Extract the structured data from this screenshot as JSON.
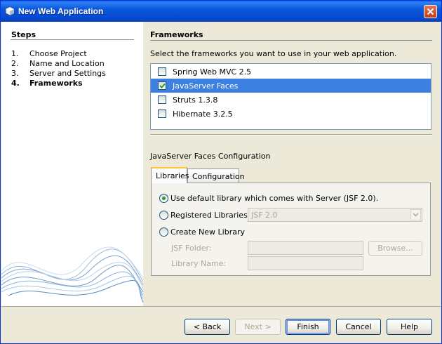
{
  "window": {
    "title": "New Web Application"
  },
  "steps": {
    "title": "Steps",
    "items": [
      {
        "num": "1.",
        "label": "Choose Project"
      },
      {
        "num": "2.",
        "label": "Name and Location"
      },
      {
        "num": "3.",
        "label": "Server and Settings"
      },
      {
        "num": "4.",
        "label": "Frameworks"
      }
    ]
  },
  "main": {
    "title": "Frameworks",
    "description": "Select the frameworks you want to use in your web application.",
    "frameworks": [
      {
        "label": "Spring Web MVC 2.5",
        "checked": false
      },
      {
        "label": "JavaServer Faces",
        "checked": true
      },
      {
        "label": "Struts 1.3.8",
        "checked": false
      },
      {
        "label": "Hibernate 3.2.5",
        "checked": false
      }
    ],
    "config_title": "JavaServer Faces Configuration",
    "tabs": [
      {
        "label": "Libraries"
      },
      {
        "label": "Configuration"
      }
    ],
    "libraries": {
      "option_default": "Use default library which comes with Server (JSF 2.0).",
      "option_registered": "Registered Libraries:",
      "registered_value": "JSF 2.0",
      "option_new": "Create New Library",
      "jsf_folder_label": "JSF Folder:",
      "library_name_label": "Library Name:",
      "browse_label": "Browse..."
    }
  },
  "buttons": {
    "back": "< Back",
    "next": "Next >",
    "finish": "Finish",
    "cancel": "Cancel",
    "help": "Help"
  },
  "colors": {
    "selection": "#3d80df",
    "titlebar": "#0a58dc",
    "accent_tab": "#ffc83c"
  }
}
